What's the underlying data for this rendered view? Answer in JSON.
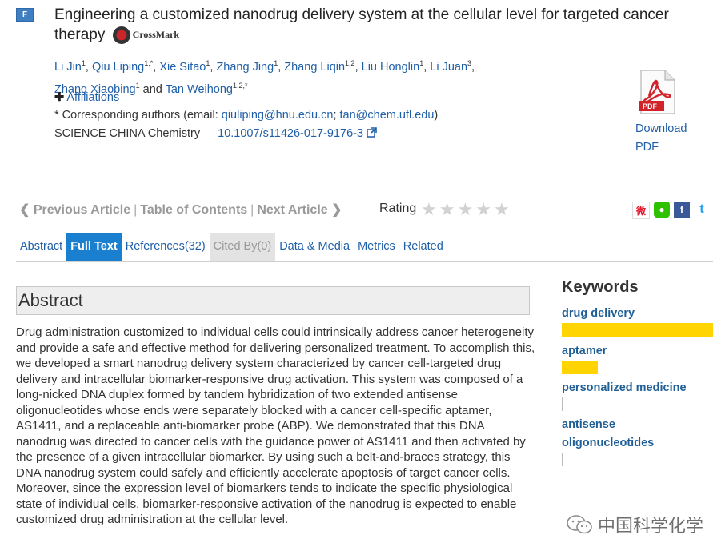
{
  "badge": "F",
  "article": {
    "title": "Engineering a customized nanodrug delivery system at the cellular level for targeted cancer therapy",
    "crossmark": "CrossMark",
    "authors": [
      {
        "name": "Li Jin",
        "sup": "1"
      },
      {
        "name": "Qiu Liping",
        "sup": "1,*"
      },
      {
        "name": "Xie Sitao",
        "sup": "1"
      },
      {
        "name": "Zhang Jing",
        "sup": "1"
      },
      {
        "name": "Zhang Liqin",
        "sup": "1,2"
      },
      {
        "name": "Liu Honglin",
        "sup": "1"
      },
      {
        "name": "Li Juan",
        "sup": "3"
      },
      {
        "name": "Zhang Xiaobing",
        "sup": "1"
      },
      {
        "name": "Tan Weihong",
        "sup": "1,2,*"
      }
    ],
    "and_word": "and",
    "affiliations_label": "Affiliations",
    "corresponding_prefix": "* Corresponding authors (email: ",
    "email1": "qiuliping@hnu.edu.cn",
    "email_sep": "; ",
    "email2": "tan@chem.ufl.edu",
    "corresponding_suffix": ")",
    "journal": "SCIENCE CHINA Chemistry",
    "doi": "10.1007/s11426-017-9176-3",
    "download_line1": "Download",
    "download_line2": "PDF"
  },
  "nav": {
    "previous": "Previous Article",
    "toc": "Table of Contents",
    "next": "Next Article",
    "rating_label": "Rating",
    "stars": 5,
    "rating_value": 0
  },
  "tabs": [
    {
      "label": "Abstract",
      "state": "normal"
    },
    {
      "label": "Full Text",
      "state": "active"
    },
    {
      "label": "References(32)",
      "state": "normal"
    },
    {
      "label": "Cited By(0)",
      "state": "disabled"
    },
    {
      "label": "Data & Media",
      "state": "normal"
    },
    {
      "label": "Metrics",
      "state": "normal"
    },
    {
      "label": "Related",
      "state": "normal"
    }
  ],
  "abstract": {
    "heading": "Abstract",
    "text": "Drug administration customized to individual cells could intrinsically address cancer heterogeneity and provide a safe and effective method for delivering personalized treatment. To accomplish this, we developed a smart nanodrug delivery system characterized by cancer cell-targeted drug delivery and intracellular biomarker-responsive drug activation. This system was composed of a long-nicked DNA duplex formed by tandem hybridization of two extended antisense oligonucleotides whose ends were separately blocked with a cancer cell-specific aptamer, AS1411, and a replaceable anti-biomarker probe (ABP). We demonstrated that this DNA nanodrug was directed to cancer cells with the guidance power of AS1411 and then activated by the presence of a given intracellular biomarker. By using such a belt-and-braces strategy, this DNA nanodrug system could safely and efficiently accelerate apoptosis of target cancer cells. Moreover, since the expression level of biomarkers tends to indicate the specific physiological state of individual cells, biomarker-responsive activation of the nanodrug is expected to enable customized drug administration at the cellular level."
  },
  "keywords": {
    "heading": "Keywords",
    "items": [
      {
        "label": "drug delivery",
        "level": 1.0
      },
      {
        "label": "aptamer",
        "level": 0.24
      },
      {
        "label": "personalized medicine",
        "level": 0
      },
      {
        "label": "antisense oligonucleotides",
        "level": 0
      }
    ]
  },
  "watermark": "中国科学化学",
  "colors": {
    "link": "#1f5fa8",
    "active_tab": "#1b7fd0",
    "keyword_bar": "#ffd400"
  },
  "share_icons": [
    "weibo-icon",
    "wechat-icon",
    "facebook-icon",
    "twitter-icon"
  ]
}
